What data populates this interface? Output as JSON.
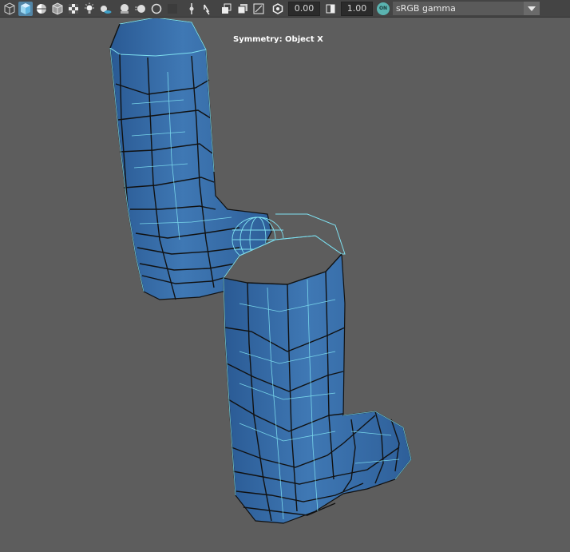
{
  "toolbar": {
    "icons": [
      {
        "name": "wireframe-cube-icon",
        "active": false
      },
      {
        "name": "shaded-cube-icon",
        "active": true
      },
      {
        "name": "wireframe-on-shaded-icon",
        "active": false
      },
      {
        "name": "textured-cube-icon",
        "active": false
      },
      {
        "name": "checker-texture-icon",
        "active": false
      },
      {
        "name": "light-bulb-icon",
        "active": false
      },
      {
        "name": "shadows-icon",
        "active": false
      },
      {
        "name": "ambient-occlusion-icon",
        "active": false
      },
      {
        "name": "motion-blur-icon",
        "active": false
      },
      {
        "name": "anti-alias-icon",
        "active": false
      },
      {
        "name": "depth-of-field-icon",
        "active": false
      },
      {
        "name": "isolate-select-icon",
        "active": false
      },
      {
        "name": "xray-icon",
        "active": false
      },
      {
        "name": "xray-joints-icon",
        "active": false
      },
      {
        "name": "xray-components-icon",
        "active": false
      },
      {
        "name": "exposure-icon",
        "active": false
      },
      {
        "name": "gamma-icon",
        "active": false
      }
    ],
    "exposure_value": "0.00",
    "gamma_value": "1.00",
    "colorspace_toggle": "ON",
    "colorspace_selected": "sRGB gamma"
  },
  "viewport": {
    "symmetry_label": "Symmetry: Object X",
    "mesh_fill": "#3b6ea8",
    "wire_color": "#7fe0f0"
  }
}
